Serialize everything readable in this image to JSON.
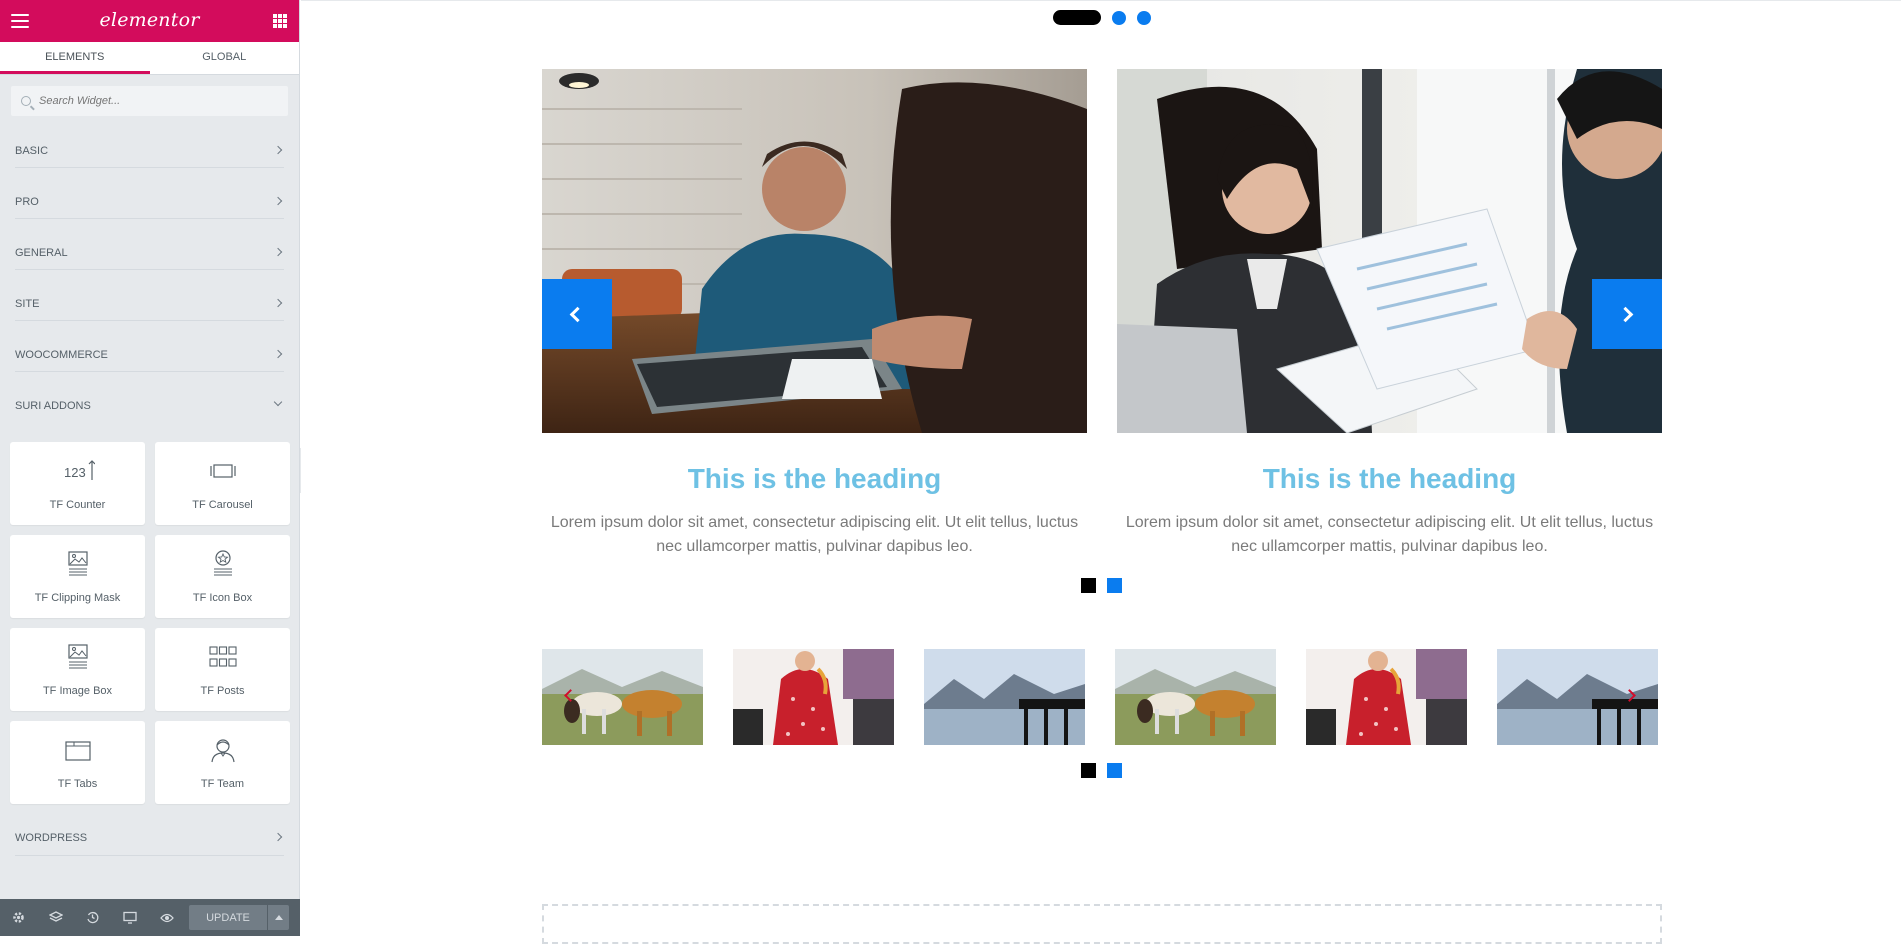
{
  "sidebar": {
    "logo": "elementor",
    "tabs": [
      {
        "label": "ELEMENTS",
        "active": true
      },
      {
        "label": "GLOBAL",
        "active": false
      }
    ],
    "search": {
      "placeholder": "Search Widget..."
    },
    "categories": [
      {
        "label": "BASIC",
        "expanded": false
      },
      {
        "label": "PRO",
        "expanded": false
      },
      {
        "label": "GENERAL",
        "expanded": false
      },
      {
        "label": "SITE",
        "expanded": false
      },
      {
        "label": "WOOCOMMERCE",
        "expanded": false
      },
      {
        "label": "SURI ADDONS",
        "expanded": true
      },
      {
        "label": "WORDPRESS",
        "expanded": false
      }
    ],
    "widgets": [
      {
        "label": "TF Counter",
        "icon": "counter-icon"
      },
      {
        "label": "TF Carousel",
        "icon": "carousel-icon"
      },
      {
        "label": "TF Clipping Mask",
        "icon": "clipping-mask-icon"
      },
      {
        "label": "TF Icon Box",
        "icon": "icon-box-icon"
      },
      {
        "label": "TF Image Box",
        "icon": "image-box-icon"
      },
      {
        "label": "TF Posts",
        "icon": "posts-grid-icon"
      },
      {
        "label": "TF Tabs",
        "icon": "tabs-icon"
      },
      {
        "label": "TF Team",
        "icon": "team-icon"
      }
    ],
    "counter_icon_text": "123",
    "footer": {
      "update_label": "UPDATE"
    }
  },
  "preview": {
    "slides": [
      {
        "heading": "This is the heading",
        "text": "Lorem ipsum dolor sit amet, consectetur adipiscing elit. Ut elit tellus, luctus nec ullamcorper mattis, pulvinar dapibus leo.",
        "image": "office-meeting-man-writing"
      },
      {
        "heading": "This is the heading",
        "text": "Lorem ipsum dolor sit amet, consectetur adipiscing elit. Ut elit tellus, luctus nec ullamcorper mattis, pulvinar dapibus leo.",
        "image": "businesswoman-interview"
      }
    ],
    "thumbnails": [
      "horses",
      "woman-red-dress",
      "lake-pier",
      "horses",
      "woman-red-dress",
      "lake-pier"
    ]
  },
  "colors": {
    "brand": "#d30c5c",
    "accent_blue": "#0a7cef",
    "heading": "#6ec1e4",
    "sidebar_bg": "#e6e9ec",
    "footer_bg": "#556068"
  }
}
